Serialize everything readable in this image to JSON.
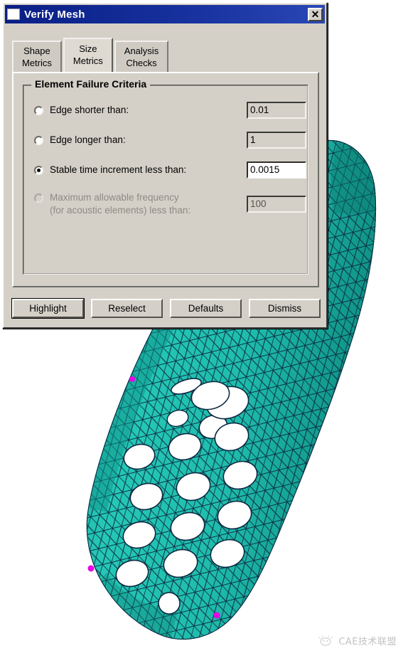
{
  "window": {
    "title": "Verify Mesh",
    "icon": "window-icon",
    "close_label": "✕",
    "titlebar_color": "#16309c"
  },
  "tabs": [
    {
      "line1": "Shape",
      "line2": "Metrics",
      "active": false,
      "name": "tab-shape-metrics"
    },
    {
      "line1": "Size",
      "line2": "Metrics",
      "active": true,
      "name": "tab-size-metrics"
    },
    {
      "line1": "Analysis",
      "line2": "Checks",
      "active": false,
      "name": "tab-analysis-checks"
    }
  ],
  "group": {
    "title": "Element Failure Criteria",
    "criteria": [
      {
        "label_line1": "Edge shorter than:",
        "label_line2": "",
        "value": "0.01",
        "selected": false,
        "disabled": false
      },
      {
        "label_line1": "Edge longer than:",
        "label_line2": "",
        "value": "1",
        "selected": false,
        "disabled": false
      },
      {
        "label_line1": "Stable time increment less than:",
        "label_line2": "",
        "value": "0.0015",
        "selected": true,
        "disabled": false
      },
      {
        "label_line1": "Maximum allowable frequency",
        "label_line2": "(for acoustic elements) less than:",
        "value": "100",
        "selected": false,
        "disabled": true
      }
    ]
  },
  "buttons": [
    {
      "label": "Highlight",
      "name": "highlight-button",
      "default": true
    },
    {
      "label": "Reselect",
      "name": "reselect-button",
      "default": false
    },
    {
      "label": "Defaults",
      "name": "defaults-button",
      "default": false
    },
    {
      "label": "Dismiss",
      "name": "dismiss-button",
      "default": false
    }
  ],
  "viewport": {
    "model_name": "mobile-phone-shell-tetrahedral-mesh",
    "mesh_fill_color": "#1fbcab",
    "mesh_edge_color": "#0c2a42",
    "highlight_marker_color": "#e800e8",
    "background_color": "#ffffff"
  },
  "watermark": {
    "text": "CAE技术联盟"
  }
}
